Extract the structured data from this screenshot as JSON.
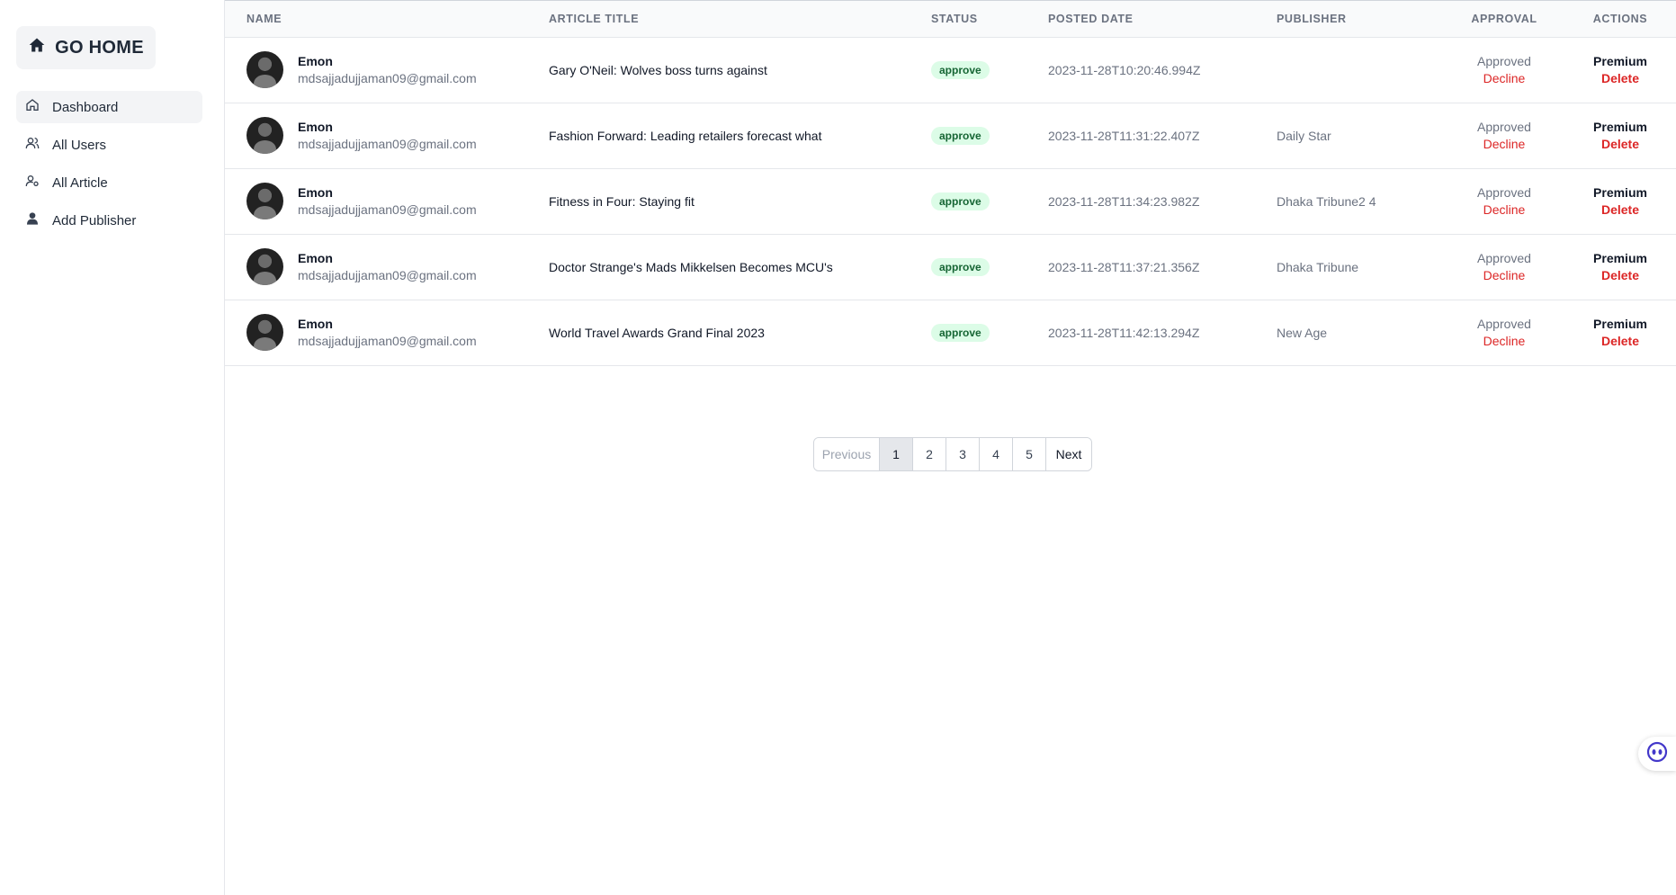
{
  "sidebar": {
    "go_home_label": "GO HOME",
    "items": [
      {
        "label": "Dashboard",
        "icon": "home-icon",
        "active": true
      },
      {
        "label": "All Users",
        "icon": "users-icon"
      },
      {
        "label": "All Article",
        "icon": "user-edit-icon"
      },
      {
        "label": "Add Publisher",
        "icon": "user-icon"
      }
    ]
  },
  "table": {
    "headers": [
      "NAME",
      "ARTICLE TITLE",
      "STATUS",
      "POSTED DATE",
      "PUBLISHER",
      "APPROVAL",
      "ACTIONS"
    ],
    "rows": [
      {
        "name": "Emon",
        "email": "mdsajjadujjaman09@gmail.com",
        "title": "Gary O'Neil: Wolves boss turns against",
        "status": "approve",
        "date": "2023-11-28T10:20:46.994Z",
        "publisher": "",
        "approval": "Approved",
        "decline": "Decline",
        "premium": "Premium",
        "delete": "Delete"
      },
      {
        "name": "Emon",
        "email": "mdsajjadujjaman09@gmail.com",
        "title": "Fashion Forward: Leading retailers forecast what",
        "status": "approve",
        "date": "2023-11-28T11:31:22.407Z",
        "publisher": "Daily Star",
        "approval": "Approved",
        "decline": "Decline",
        "premium": "Premium",
        "delete": "Delete"
      },
      {
        "name": "Emon",
        "email": "mdsajjadujjaman09@gmail.com",
        "title": "Fitness in Four: Staying fit",
        "status": "approve",
        "date": "2023-11-28T11:34:23.982Z",
        "publisher": "Dhaka Tribune2 4",
        "approval": "Approved",
        "decline": "Decline",
        "premium": "Premium",
        "delete": "Delete"
      },
      {
        "name": "Emon",
        "email": "mdsajjadujjaman09@gmail.com",
        "title": "Doctor Strange's Mads Mikkelsen Becomes MCU's",
        "status": "approve",
        "date": "2023-11-28T11:37:21.356Z",
        "publisher": "Dhaka Tribune",
        "approval": "Approved",
        "decline": "Decline",
        "premium": "Premium",
        "delete": "Delete"
      },
      {
        "name": "Emon",
        "email": "mdsajjadujjaman09@gmail.com",
        "title": "World Travel Awards Grand Final 2023",
        "status": "approve",
        "date": "2023-11-28T11:42:13.294Z",
        "publisher": "New Age",
        "approval": "Approved",
        "decline": "Decline",
        "premium": "Premium",
        "delete": "Delete"
      }
    ]
  },
  "pagination": {
    "previous": "Previous",
    "pages": [
      "1",
      "2",
      "3",
      "4",
      "5"
    ],
    "current": "1",
    "next": "Next"
  },
  "colors": {
    "badge_bg": "#dcfce7",
    "badge_text": "#166534",
    "danger": "#dc2626",
    "muted": "#6b7280"
  },
  "widgets": {
    "chat_icon": "chat-bot-icon"
  }
}
